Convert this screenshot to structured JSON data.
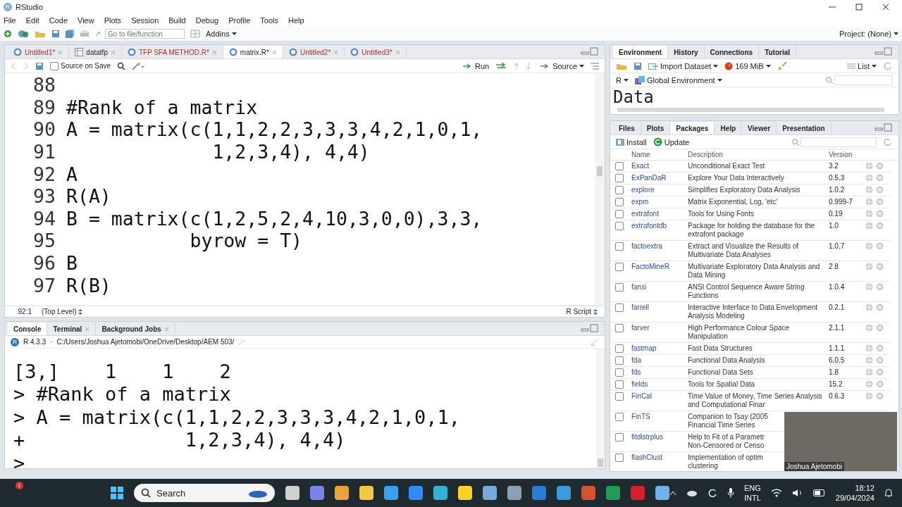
{
  "window": {
    "title": "RStudio",
    "logo": "R"
  },
  "menu": [
    "File",
    "Edit",
    "Code",
    "View",
    "Plots",
    "Session",
    "Build",
    "Debug",
    "Profile",
    "Tools",
    "Help"
  ],
  "toolbar": {
    "goto_placeholder": "Go to file/function",
    "addins": "Addins",
    "project": "Project: (None)"
  },
  "source": {
    "tabs": [
      {
        "label": "Untitled1*",
        "kind": "script",
        "unsaved": true,
        "selected": false
      },
      {
        "label": "datatfp",
        "kind": "data",
        "unsaved": false,
        "selected": false
      },
      {
        "label": "TFP SFA METHOD.R*",
        "kind": "script",
        "unsaved": true,
        "selected": false
      },
      {
        "label": "matrix.R*",
        "kind": "script",
        "unsaved": false,
        "selected": true
      },
      {
        "label": "Untitled2*",
        "kind": "script",
        "unsaved": true,
        "selected": false
      },
      {
        "label": "Untitled3*",
        "kind": "script",
        "unsaved": true,
        "selected": false
      }
    ],
    "source_on_save": {
      "label": "Source on Save",
      "checked": false
    },
    "run": "Run",
    "source": "Source",
    "lines": [
      {
        "number": "88"
      },
      {
        "number": "89",
        "code": "#Rank of a matrix"
      },
      {
        "number": "90",
        "code": "A = matrix(c(1,1,2,2,3,3,3,4,2,1,0,1,"
      },
      {
        "number": "91",
        "code": "             1,2,3,4), 4,4)"
      },
      {
        "number": "92",
        "code": "A"
      },
      {
        "number": "93",
        "code": "R(A)"
      },
      {
        "number": "94",
        "code": "B = matrix(c(1,2,5,2,4,10,3,0,0),3,3,"
      },
      {
        "number": "95",
        "code": "           byrow = T)"
      },
      {
        "number": "96",
        "code": "B"
      },
      {
        "number": "97",
        "code": "R(B)"
      }
    ],
    "position": "92:1",
    "scope": "(Top Level)",
    "file_type": "R Script"
  },
  "console": {
    "tabs": [
      {
        "label": "Console",
        "selected": true
      },
      {
        "label": "Terminal",
        "selected": false
      },
      {
        "label": "Background Jobs",
        "selected": false
      }
    ],
    "logo": "R",
    "version": "R 4.3.3",
    "separator": "·",
    "path": "C:/Users/Joshua Ajetomobi/OneDrive/Desktop/AEM 503/",
    "lines": [
      "[3,]    1    1    2",
      "> #Rank of a matrix",
      "> A = matrix(c(1,1,2,2,3,3,3,4,2,1,0,1,",
      "+              1,2,3,4), 4,4)",
      ">"
    ]
  },
  "environment": {
    "tabs": [
      {
        "label": "Environment",
        "selected": true
      },
      {
        "label": "History",
        "selected": false
      },
      {
        "label": "Connections",
        "selected": false
      },
      {
        "label": "Tutorial",
        "selected": false
      }
    ],
    "import": "Import Dataset",
    "memory": "169 MiB",
    "view": "List",
    "language": "R",
    "scope": "Global Environment",
    "content": "Data"
  },
  "packages": {
    "tabs": [
      {
        "label": "Files",
        "selected": false
      },
      {
        "label": "Plots",
        "selected": false
      },
      {
        "label": "Packages",
        "selected": true
      },
      {
        "label": "Help",
        "selected": false
      },
      {
        "label": "Viewer",
        "selected": false
      },
      {
        "label": "Presentation",
        "selected": false
      }
    ],
    "install": "Install",
    "update": "Update",
    "columns": [
      "Name",
      "Description",
      "Version"
    ],
    "rows": [
      {
        "name": "Exact",
        "description": "Unconditional Exact Test",
        "version": "3.2",
        "checked": false
      },
      {
        "name": "ExPanDaR",
        "description": "Explore Your Data Interactively",
        "version": "0.5.3",
        "checked": false
      },
      {
        "name": "explore",
        "description": "Simplifies Exploratory Data Analysis",
        "version": "1.0.2",
        "checked": false
      },
      {
        "name": "expm",
        "description": "Matrix Exponential, Log, 'etc'",
        "version": "0.999-7",
        "checked": false
      },
      {
        "name": "extrafont",
        "description": "Tools for Using Fonts",
        "version": "0.19",
        "checked": false
      },
      {
        "name": "extrafontdb",
        "description": "Package for holding the database for the extrafont package",
        "version": "1.0",
        "checked": false
      },
      {
        "name": "factoextra",
        "description": "Extract and Visualize the Results of Multivariate Data Analyses",
        "version": "1.0.7",
        "checked": false
      },
      {
        "name": "FactoMineR",
        "description": "Multivariate Exploratory Data Analysis and Data Mining",
        "version": "2.8",
        "checked": false
      },
      {
        "name": "fansi",
        "description": "ANSI Control Sequence Aware String Functions",
        "version": "1.0.4",
        "checked": false
      },
      {
        "name": "farrell",
        "description": "Interactive Interface to Data Envelopment Analysis Modeling",
        "version": "0.2.1",
        "checked": false
      },
      {
        "name": "farver",
        "description": "High Performance Colour Space Manipulation",
        "version": "2.1.1",
        "checked": false
      },
      {
        "name": "fastmap",
        "description": "Fast Data Structures",
        "version": "1.1.1",
        "checked": false
      },
      {
        "name": "fda",
        "description": "Functional Data Analysis",
        "version": "6.0.5",
        "checked": false
      },
      {
        "name": "fds",
        "description": "Functional Data Sets",
        "version": "1.8",
        "checked": false
      },
      {
        "name": "fields",
        "description": "Tools for Spatial Data",
        "version": "15.2",
        "checked": false
      },
      {
        "name": "FinCal",
        "description": "Time Value of Money, Time Series Analysis and Computational Finar",
        "version": "0.6.3",
        "checked": false
      },
      {
        "name": "FinTS",
        "description": "Companion to Tsay (2005 Financial Time Series",
        "checked": false
      },
      {
        "name": "fitdistrplus",
        "description": "Help to Fit of a Parametr Non-Censored or Censo",
        "checked": false
      },
      {
        "name": "flashClust",
        "description": "Implementation of optim clustering",
        "checked": false
      }
    ]
  },
  "webcam": {
    "name": "Joshua Ajetomobi"
  },
  "taskbar": {
    "notification_count": "1",
    "search": "Search",
    "language": "ENG",
    "layout": "INTL",
    "time": "18:12",
    "date": "29/04/2024"
  }
}
